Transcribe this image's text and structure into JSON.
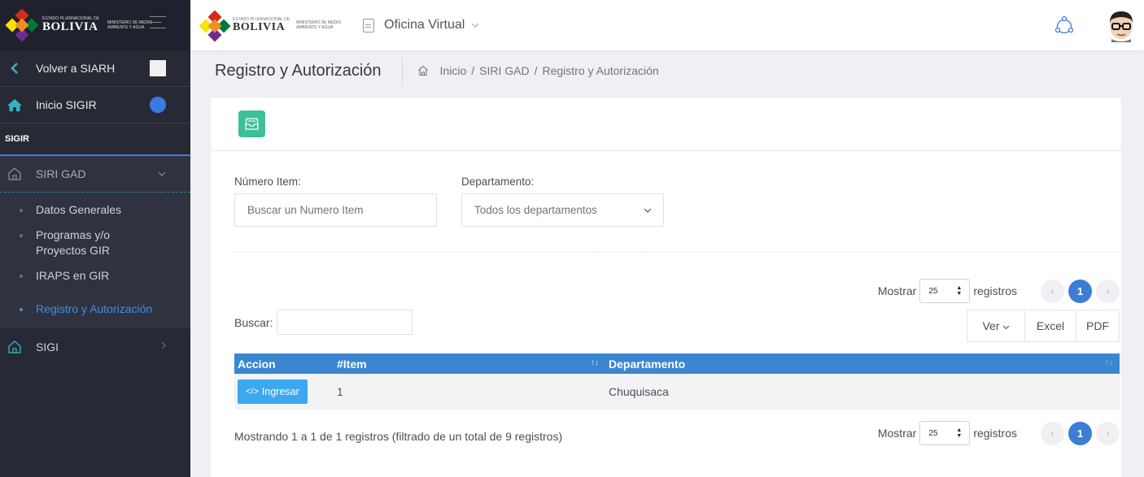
{
  "sidebar": {
    "logo": {
      "small": "ESTADO PLURINACIONAL DE",
      "big": "BOLIVIA",
      "ministry": "MINISTERIO DE MEDIO AMBIENTE Y AGUA"
    },
    "back_label": "Volver a SIARH",
    "home_label": "Inicio SIGIR",
    "section": "SIGIR",
    "group_label": "SIRI GAD",
    "sub_items": [
      {
        "label": "Datos Generales"
      },
      {
        "label": "Programas y/o Proyectos GIR"
      },
      {
        "label": "IRAPS en GIR"
      },
      {
        "label": "Registro y Autorización"
      }
    ],
    "sigi_label": "SIGI"
  },
  "topbar": {
    "logo": {
      "small": "ESTADO PLURINACIONAL DE",
      "big": "BOLIVIA",
      "ministry": "MINISTERIO DE MEDIO AMBIENTE Y AGUA"
    },
    "app_label": "Oficina Virtual"
  },
  "page": {
    "title": "Registro y Autorización",
    "breadcrumbs": [
      "Inicio",
      "SIRI GAD",
      "Registro y Autorización"
    ]
  },
  "filters": {
    "item_label": "Número Item:",
    "item_placeholder": "Buscar un Numero Item",
    "dept_label": "Departamento:",
    "dept_value": "Todos los departamentos"
  },
  "table_controls": {
    "show_label": "Mostrar",
    "page_length": "25",
    "records_label": "registros",
    "current_page": "1",
    "search_label": "Buscar:",
    "ver_label": "Ver",
    "excel_label": "Excel",
    "pdf_label": "PDF"
  },
  "table": {
    "headers": [
      "Accion",
      "#Item",
      "Departamento"
    ],
    "rows": [
      {
        "action": "Ingresar",
        "item": "1",
        "departamento": "Chuquisaca"
      }
    ]
  },
  "info_text": "Mostrando 1 a 1 de 1 registros (filtrado de un total de 9 registros)",
  "colors": {
    "primary": "#3b86d1",
    "accent": "#3cbf9a",
    "sidebar": "#272a35"
  }
}
